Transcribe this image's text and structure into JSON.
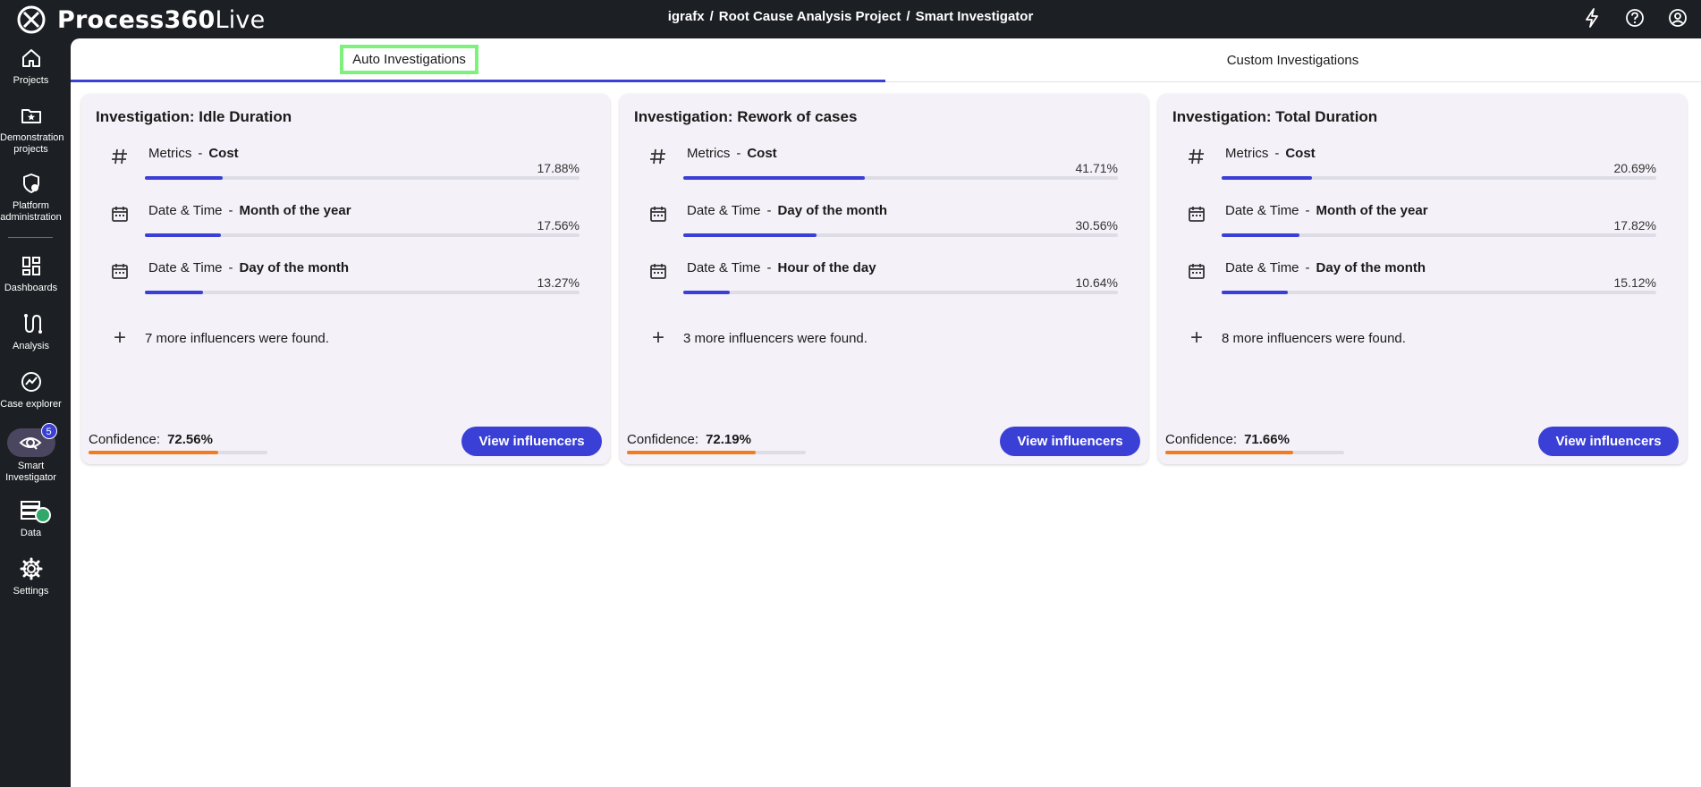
{
  "app": {
    "logo_bold": "Process360",
    "logo_light": "Live"
  },
  "breadcrumb": [
    "igrafx",
    "Root Cause Analysis Project",
    "Smart Investigator"
  ],
  "breadcrumb_separator": "/",
  "top_icons": [
    "lightning-icon",
    "help-icon",
    "user-account-icon"
  ],
  "sidebar": {
    "items": [
      {
        "label": "Projects",
        "icon": "home-icon"
      },
      {
        "label": "Demonstration projects",
        "icon": "folder-star-icon"
      },
      {
        "label": "Platform administration",
        "icon": "shield-gear-icon"
      },
      {
        "label": "Dashboards",
        "icon": "dashboard-icon"
      },
      {
        "label": "Analysis",
        "icon": "route-icon"
      },
      {
        "label": "Case explorer",
        "icon": "chart-circle-icon"
      },
      {
        "label": "Smart Investigator",
        "icon": "eye-search-icon",
        "badge": "5"
      },
      {
        "label": "Data",
        "icon": "data-check-icon"
      },
      {
        "label": "Settings",
        "icon": "gear-icon"
      }
    ]
  },
  "tabs": {
    "auto": "Auto Investigations",
    "custom": "Custom Investigations"
  },
  "colors": {
    "accent": "#3a3fd6",
    "confidence": "#f07c1e",
    "card_bg": "#f5f1f8",
    "highlight": "#7cf27c"
  },
  "cards": [
    {
      "title": "Investigation: Idle Duration",
      "influencers": [
        {
          "icon": "hash-icon",
          "category": "Metrics",
          "name": "Cost",
          "pct": "17.88%",
          "value": 0.1788
        },
        {
          "icon": "calendar-icon",
          "category": "Date & Time",
          "name": "Month of the year",
          "pct": "17.56%",
          "value": 0.1756
        },
        {
          "icon": "calendar-icon",
          "category": "Date & Time",
          "name": "Day of the month",
          "pct": "13.27%",
          "value": 0.1327
        }
      ],
      "more": "7 more influencers were found.",
      "confidence_label": "Confidence:",
      "confidence": "72.56%",
      "confidence_value": 0.7256,
      "button": "View influencers"
    },
    {
      "title": "Investigation: Rework of cases",
      "influencers": [
        {
          "icon": "hash-icon",
          "category": "Metrics",
          "name": "Cost",
          "pct": "41.71%",
          "value": 0.4171
        },
        {
          "icon": "calendar-icon",
          "category": "Date & Time",
          "name": "Day of the month",
          "pct": "30.56%",
          "value": 0.3056
        },
        {
          "icon": "calendar-icon",
          "category": "Date & Time",
          "name": "Hour of the day",
          "pct": "10.64%",
          "value": 0.1064
        }
      ],
      "more": "3 more influencers were found.",
      "confidence_label": "Confidence:",
      "confidence": "72.19%",
      "confidence_value": 0.7219,
      "button": "View influencers"
    },
    {
      "title": "Investigation: Total Duration",
      "influencers": [
        {
          "icon": "hash-icon",
          "category": "Metrics",
          "name": "Cost",
          "pct": "20.69%",
          "value": 0.2069
        },
        {
          "icon": "calendar-icon",
          "category": "Date & Time",
          "name": "Month of the year",
          "pct": "17.82%",
          "value": 0.1782
        },
        {
          "icon": "calendar-icon",
          "category": "Date & Time",
          "name": "Day of the month",
          "pct": "15.12%",
          "value": 0.1512
        }
      ],
      "more": "8 more influencers were found.",
      "confidence_label": "Confidence:",
      "confidence": "71.66%",
      "confidence_value": 0.7166,
      "button": "View influencers"
    }
  ]
}
